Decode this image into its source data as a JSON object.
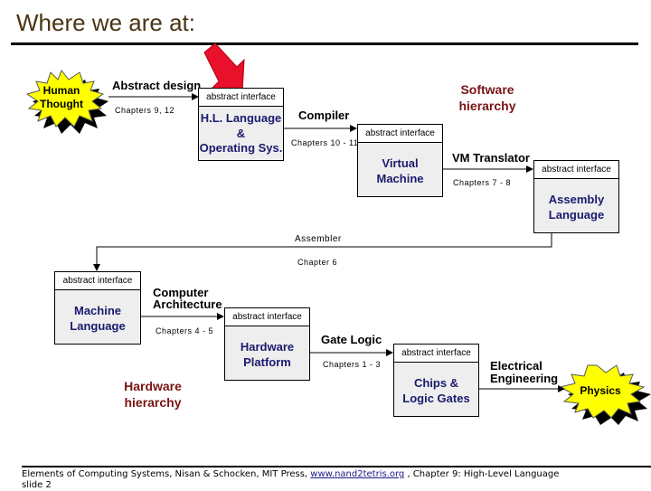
{
  "slide": {
    "title": "Where we are at:",
    "accent_colors": {
      "title": "#4a3414",
      "hierarchy_label": "#7a1414",
      "box_text": "#1a1a6e",
      "burst_fill": "#ffff00",
      "pointer_arrow": "#e8102a"
    }
  },
  "diagram": {
    "sources": {
      "human_thought": {
        "line1": "Human",
        "line2": "Thought"
      },
      "physics": {
        "label": "Physics"
      }
    },
    "hierarchy_labels": {
      "software": {
        "line1": "Software",
        "line2": "hierarchy"
      },
      "hardware": {
        "line1": "Hardware",
        "line2": "hierarchy"
      }
    },
    "boxes": [
      {
        "id": "hl-language",
        "header": "abstract interface",
        "line1": "H.L. Language",
        "line2": "&",
        "line3": "Operating Sys."
      },
      {
        "id": "virtual-machine",
        "header": "abstract interface",
        "line1": "Virtual",
        "line2": "Machine"
      },
      {
        "id": "assembly-language",
        "header": "abstract interface",
        "line1": "Assembly",
        "line2": "Language"
      },
      {
        "id": "machine-language",
        "header": "abstract interface",
        "line1": "Machine",
        "line2": "Language"
      },
      {
        "id": "hardware-platform",
        "header": "abstract interface",
        "line1": "Hardware",
        "line2": "Platform"
      },
      {
        "id": "chips-logic-gates",
        "header": "abstract interface",
        "line1": "Chips &",
        "line2": "Logic Gates"
      }
    ],
    "transitions": [
      {
        "id": "abstract-design",
        "label": "Abstract design",
        "chapters": "Chapters 9, 12"
      },
      {
        "id": "compiler",
        "label": "Compiler",
        "chapters": "Chapters 10 - 11"
      },
      {
        "id": "vm-translator",
        "label": "VM Translator",
        "chapters": "Chapters 7 - 8"
      },
      {
        "id": "assembler",
        "label": "Assembler",
        "chapters": "Chapter 6"
      },
      {
        "id": "computer-architecture",
        "label_line1": "Computer",
        "label_line2": "Architecture",
        "chapters": "Chapters  4 - 5"
      },
      {
        "id": "gate-logic",
        "label": "Gate Logic",
        "chapters": "Chapters  1 - 3"
      },
      {
        "id": "electrical-engineering",
        "label_line1": "Electrical",
        "label_line2": "Engineering"
      }
    ]
  },
  "footer": {
    "prefix": "Elements of Computing Systems, Nisan & Schocken, MIT Press,  ",
    "link_text": "www.nand2tetris.org",
    "suffix": " , Chapter 9: High-Level Language",
    "slide_label": "slide 2"
  }
}
